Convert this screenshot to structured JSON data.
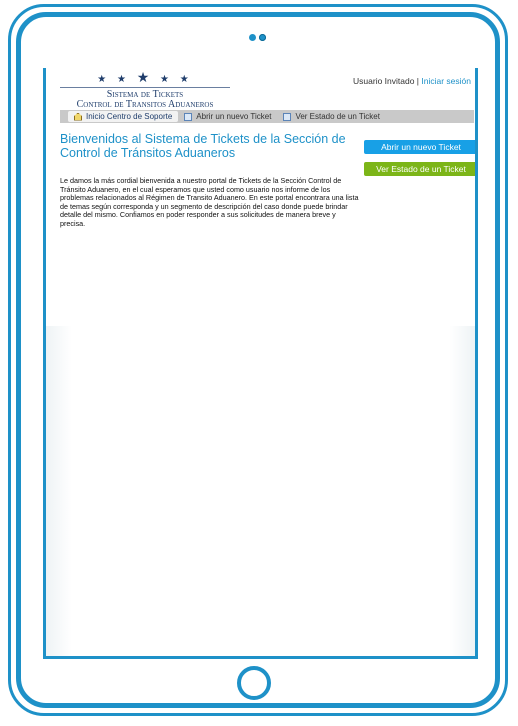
{
  "logo": {
    "stars": "★ ★ ★ ★ ★",
    "line1": "Sistema de Tickets",
    "line2": "Control de Transitos Aduaneros"
  },
  "user": {
    "label": "Usuario Invitado |",
    "login_link": "Iniciar sesión"
  },
  "nav": {
    "items": [
      {
        "label": "Inicio Centro de Soporte",
        "icon": "home-icon"
      },
      {
        "label": "Abrir un nuevo Ticket",
        "icon": "new-ticket-icon"
      },
      {
        "label": "Ver Estado de un Ticket",
        "icon": "ticket-status-icon"
      }
    ]
  },
  "main": {
    "title": "Bienvenidos al Sistema de Tickets de la Sección de Control de Tránsitos Aduaneros",
    "body": "Le damos la más cordial bienvenida a nuestro portal de Tickets de la Sección Control de Tránsito Aduanero, en el cual esperamos que usted como usuario nos informe de los problemas relacionados al Régimen de Transito Aduanero. En este portal encontrara una lista de temas según corresponda y un segmento de descripción del caso donde puede brindar detalle del mismo. Confiamos en poder responder a sus solicitudes de manera breve y precisa."
  },
  "buttons": {
    "open_ticket": "Abrir un nuevo Ticket",
    "check_status": "Ver Estado de un Ticket"
  },
  "colors": {
    "frame": "#1e91c8",
    "accent": "#1e91c8",
    "button_blue": "#18a0e6",
    "button_green": "#7cb518"
  }
}
